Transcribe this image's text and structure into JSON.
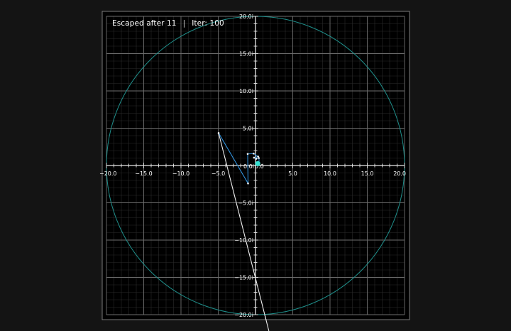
{
  "status": {
    "escaped_text": "Escaped after 11",
    "separator": "|",
    "iter_text": "Iter: 100"
  },
  "colors": {
    "background": "#141414",
    "plot_background": "#000000",
    "minor_grid": "#2b2b2b",
    "major_grid": "#6e6e6e",
    "axis": "#e6e6e6",
    "escape_circle": "#1f8f8b",
    "orbit": "#2f8fd8",
    "escape_step": "#f0f0f0",
    "start_point": "#35e0d0"
  },
  "plot": {
    "x_range": [
      -20,
      20
    ],
    "y_range": [
      -20,
      20
    ],
    "escape_radius": 20,
    "x_ticks": [
      {
        "v": -20,
        "label": "−20.0"
      },
      {
        "v": -15,
        "label": "−15.0"
      },
      {
        "v": -10,
        "label": "−10.0"
      },
      {
        "v": -5,
        "label": "−5.0"
      },
      {
        "v": 5,
        "label": "5.0"
      },
      {
        "v": 10,
        "label": "10.0"
      },
      {
        "v": 15,
        "label": "15.0"
      },
      {
        "v": 20,
        "label": "20.0"
      }
    ],
    "y_ticks": [
      {
        "v": 20,
        "label": "20.0i"
      },
      {
        "v": 15,
        "label": "15.0i"
      },
      {
        "v": 10,
        "label": "10.0i"
      },
      {
        "v": 5,
        "label": "5.0i"
      },
      {
        "v": -5,
        "label": "−5.0i"
      },
      {
        "v": -10,
        "label": "−10.0i"
      },
      {
        "v": -15,
        "label": "−15.0i"
      },
      {
        "v": -20,
        "label": "−20.0i"
      }
    ],
    "origin_label": "0.0",
    "origin_imag_label": "0.0i",
    "orbit_points": [
      [
        0.3,
        0.25
      ],
      [
        0.5,
        0.35
      ],
      [
        0.45,
        1.0
      ],
      [
        0.1,
        0.9
      ],
      [
        -0.2,
        1.05
      ],
      [
        0.35,
        1.2
      ],
      [
        -0.25,
        1.6
      ],
      [
        -1.05,
        1.55
      ],
      [
        -1.0,
        -2.4
      ],
      [
        -4.95,
        4.35
      ]
    ],
    "escape_point": [
      2.0,
      -23.0
    ]
  }
}
